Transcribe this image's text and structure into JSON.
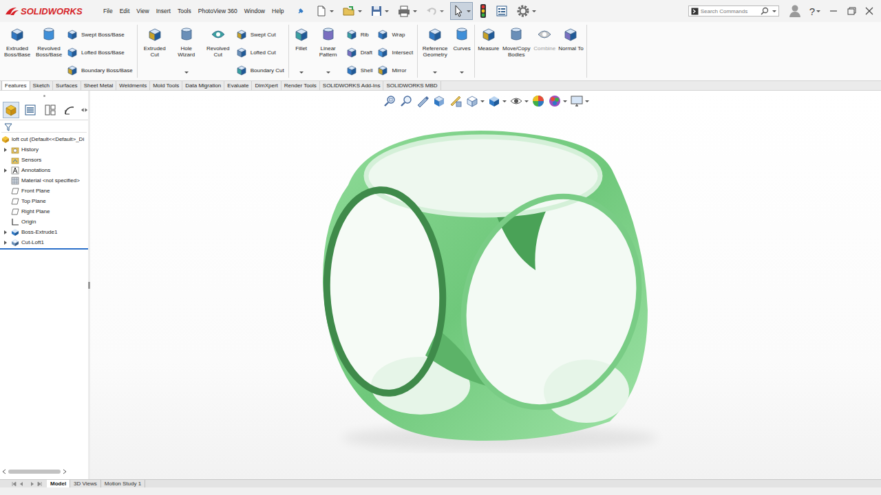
{
  "app": {
    "logo": "SOLIDWORKS"
  },
  "menu": [
    "File",
    "Edit",
    "View",
    "Insert",
    "Tools",
    "PhotoView 360",
    "Window",
    "Help"
  ],
  "quick_toolbar": [
    {
      "dropdown": true,
      "disabled": false,
      "selected": false
    },
    {
      "dropdown": true,
      "disabled": false,
      "selected": false
    },
    {
      "dropdown": true,
      "disabled": false,
      "selected": false
    },
    {
      "dropdown": true,
      "disabled": false,
      "selected": false
    },
    {
      "dropdown": true,
      "disabled": true,
      "selected": false
    },
    {
      "dropdown": true,
      "disabled": false,
      "selected": true
    },
    {
      "dropdown": false,
      "disabled": false,
      "selected": false
    },
    {
      "dropdown": false,
      "disabled": false,
      "selected": false
    },
    {
      "dropdown": true,
      "disabled": false,
      "selected": false
    }
  ],
  "search": {
    "placeholder": "Search Commands"
  },
  "help": {
    "label": "?",
    "dropdown": true
  },
  "ribbon": {
    "groups": [
      {
        "big": [
          {
            "label": "Extruded Boss/Base",
            "dropdown": false,
            "disabled": false
          },
          {
            "label": "Revolved Boss/Base",
            "dropdown": false,
            "disabled": false
          }
        ],
        "small_columns": [
          [
            {
              "label": "Swept Boss/Base"
            },
            {
              "label": "Lofted Boss/Base"
            },
            {
              "label": "Boundary Boss/Base"
            }
          ]
        ]
      },
      {
        "big": [
          {
            "label": "Extruded Cut",
            "dropdown": false,
            "disabled": false
          },
          {
            "label": "Hole Wizard",
            "dropdown": true,
            "disabled": false
          },
          {
            "label": "Revolved Cut",
            "dropdown": false,
            "disabled": false
          }
        ],
        "small_columns": [
          [
            {
              "label": "Swept Cut"
            },
            {
              "label": "Lofted Cut"
            },
            {
              "label": "Boundary Cut"
            }
          ]
        ]
      },
      {
        "big": [
          {
            "label": "Fillet",
            "dropdown": true,
            "disabled": false
          },
          {
            "label": "Linear Pattern",
            "dropdown": true,
            "disabled": false
          }
        ],
        "small_columns": [
          [
            {
              "label": "Rib"
            },
            {
              "label": "Draft"
            },
            {
              "label": "Shell"
            }
          ],
          [
            {
              "label": "Wrap"
            },
            {
              "label": "Intersect"
            },
            {
              "label": "Mirror"
            }
          ]
        ]
      },
      {
        "big": [
          {
            "label": "Reference Geometry",
            "dropdown": true,
            "disabled": false
          },
          {
            "label": "Curves",
            "dropdown": true,
            "disabled": false
          }
        ],
        "small_columns": []
      },
      {
        "big": [
          {
            "label": "Measure",
            "dropdown": false,
            "disabled": false
          },
          {
            "label": "Move/Copy Bodies",
            "dropdown": false,
            "disabled": false
          },
          {
            "label": "Combine",
            "dropdown": false,
            "disabled": true
          },
          {
            "label": "Normal To",
            "dropdown": false,
            "disabled": false
          }
        ],
        "small_columns": []
      }
    ]
  },
  "tabs": [
    {
      "label": "Features",
      "selected": true
    },
    {
      "label": "Sketch",
      "selected": false
    },
    {
      "label": "Surfaces",
      "selected": false
    },
    {
      "label": "Sheet Metal",
      "selected": false
    },
    {
      "label": "Weldments",
      "selected": false
    },
    {
      "label": "Mold Tools",
      "selected": false
    },
    {
      "label": "Data Migration",
      "selected": false
    },
    {
      "label": "Evaluate",
      "selected": false
    },
    {
      "label": "DimXpert",
      "selected": false
    },
    {
      "label": "Render Tools",
      "selected": false
    },
    {
      "label": "SOLIDWORKS Add-Ins",
      "selected": false
    },
    {
      "label": "SOLIDWORKS MBD",
      "selected": false
    }
  ],
  "panel_tabs": [
    {
      "selected": true
    },
    {
      "selected": false
    },
    {
      "selected": false
    },
    {
      "selected": false
    }
  ],
  "tree": {
    "root": "loft cut (Default<<Default>_Di",
    "items": [
      {
        "label": "History",
        "kind": "history",
        "expandable": true
      },
      {
        "label": "Sensors",
        "kind": "sensor",
        "expandable": false
      },
      {
        "label": "Annotations",
        "kind": "annotation",
        "expandable": true
      },
      {
        "label": "Material <not specified>",
        "kind": "material",
        "expandable": false
      },
      {
        "label": "Front Plane",
        "kind": "plane",
        "expandable": false
      },
      {
        "label": "Top Plane",
        "kind": "plane",
        "expandable": false
      },
      {
        "label": "Right Plane",
        "kind": "plane",
        "expandable": false
      },
      {
        "label": "Origin",
        "kind": "origin",
        "expandable": false
      },
      {
        "label": "Boss-Extrude1",
        "kind": "extrude",
        "expandable": true
      },
      {
        "label": "Cut-Loft1",
        "kind": "cut",
        "expandable": true
      }
    ]
  },
  "view_toolbar": [
    {
      "dropdown": false
    },
    {
      "dropdown": false
    },
    {
      "dropdown": false
    },
    {
      "dropdown": false
    },
    {
      "dropdown": false
    },
    {
      "dropdown": true
    },
    {
      "dropdown": true
    },
    {
      "dropdown": true
    },
    {
      "dropdown": false
    },
    {
      "dropdown": true
    },
    {
      "dropdown": true
    }
  ],
  "bottom_tabs": [
    {
      "label": "Model",
      "selected": true
    },
    {
      "label": "3D Views",
      "selected": false
    },
    {
      "label": "Motion Study 1",
      "selected": false
    }
  ]
}
